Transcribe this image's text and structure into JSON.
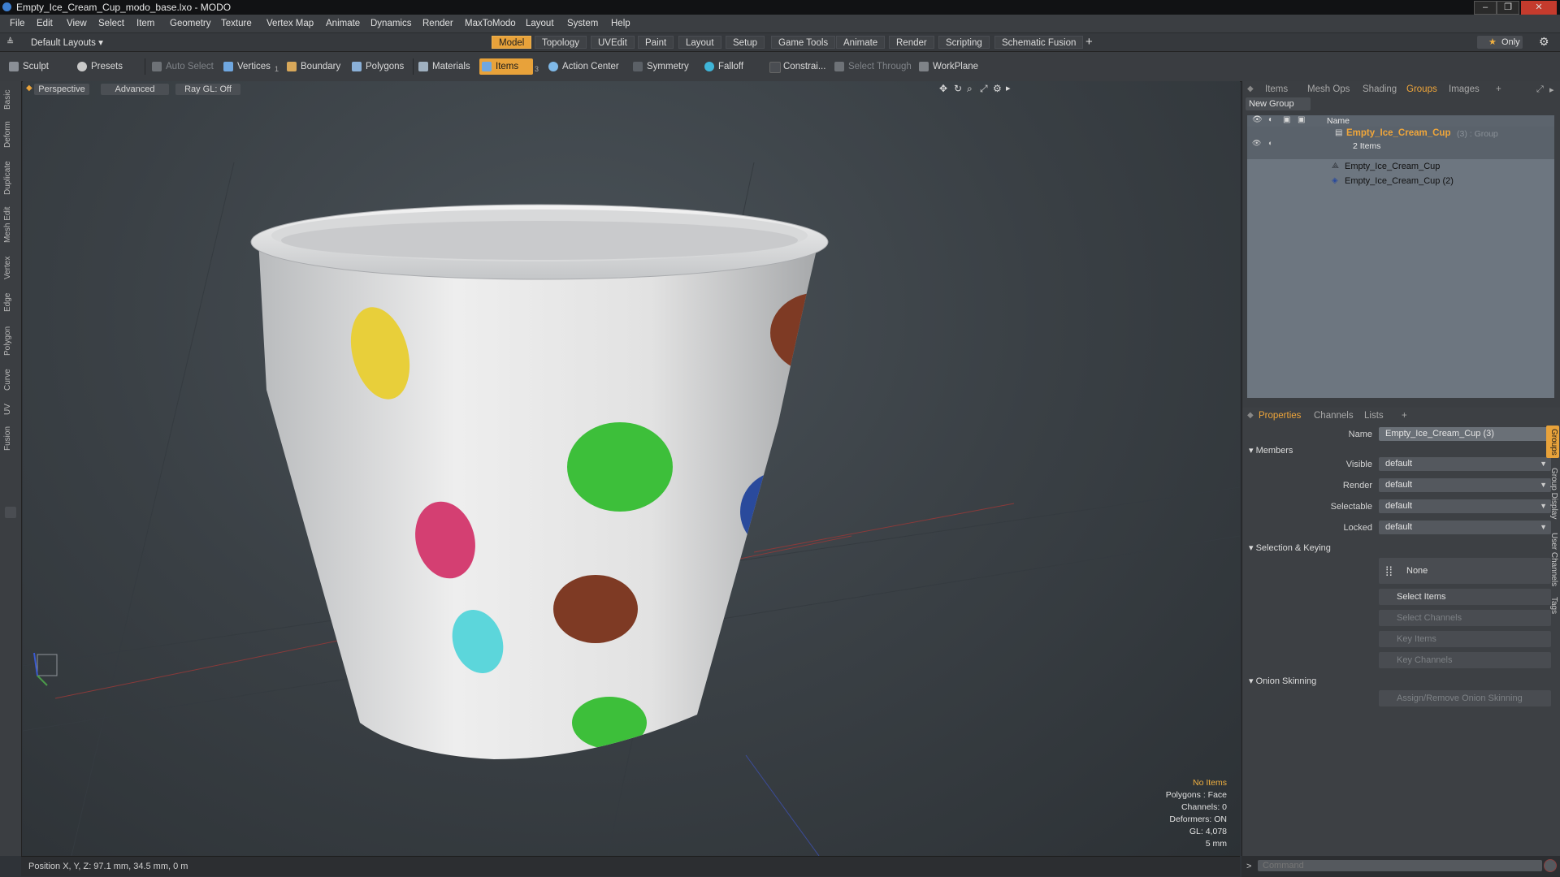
{
  "window": {
    "title": "Empty_Ice_Cream_Cup_modo_base.lxo - MODO",
    "min": "–",
    "max": "❐",
    "close": "✕"
  },
  "menu": [
    "File",
    "Edit",
    "View",
    "Select",
    "Item",
    "Geometry",
    "Texture",
    "Vertex Map",
    "Animate",
    "Dynamics",
    "Render",
    "MaxToModo",
    "Layout",
    "System",
    "Help"
  ],
  "layouts": {
    "selector": "Default Layouts ▾",
    "tabs": [
      "Model",
      "Topology",
      "UVEdit",
      "Paint",
      "Layout",
      "Setup",
      "Game Tools",
      "Animate",
      "Render",
      "Scripting",
      "Schematic Fusion"
    ],
    "active": "Model",
    "only_label": "Only",
    "add": "+"
  },
  "toolbar": {
    "sculpt": "Sculpt",
    "presets": "Presets",
    "auto_select": "Auto Select",
    "vertices": "Vertices",
    "vertices_count": "1",
    "boundary": "Boundary",
    "polygons": "Polygons",
    "materials": "Materials",
    "items": "Items",
    "items_count": "3",
    "action_center": "Action Center",
    "symmetry": "Symmetry",
    "falloff": "Falloff",
    "constraints": "Constrai...",
    "select_through": "Select Through",
    "workplane": "WorkPlane"
  },
  "left_tabs": [
    "Basic",
    "Deform",
    "Duplicate",
    "Mesh Edit",
    "Vertex",
    "Edge",
    "Polygon",
    "Curve",
    "UV",
    "Fusion"
  ],
  "viewport": {
    "view": "Perspective",
    "shading": "Advanced",
    "raygl": "Ray GL: Off",
    "info": {
      "selection": "No Items",
      "polygons": "Polygons : Face",
      "channels": "Channels: 0",
      "deformers": "Deformers: ON",
      "gl": "GL: 4,078",
      "grid": "5 mm"
    },
    "colors": {
      "dot_yellow": "#e8cf3a",
      "dot_brown": "#7e3a24",
      "dot_green": "#3dbf3a",
      "dot_blue": "#2a4a9c",
      "dot_pink": "#d43f72",
      "dot_cyan": "#5cd6db",
      "dot_orange": "#e07722"
    }
  },
  "status": {
    "position": "Position X, Y, Z:  97.1 mm, 34.5 mm, 0 m"
  },
  "right_top": {
    "tabs": [
      "Items",
      "Mesh Ops",
      "Shading",
      "Groups",
      "Images"
    ],
    "active": "Groups",
    "add": "+",
    "new_group": "New Group",
    "column_name": "Name",
    "group": {
      "name": "Empty_Ice_Cream_Cup",
      "suffix": "(3) : Group",
      "count": "2 Items"
    },
    "children": [
      "Empty_Ice_Cream_Cup",
      "Empty_Ice_Cream_Cup (2)"
    ]
  },
  "properties": {
    "tabs": [
      "Properties",
      "Channels",
      "Lists"
    ],
    "active": "Properties",
    "add": "+",
    "name_label": "Name",
    "name_value": "Empty_Ice_Cream_Cup (3)",
    "members_head": "Members",
    "rows": [
      {
        "label": "Visible",
        "value": "default"
      },
      {
        "label": "Render",
        "value": "default"
      },
      {
        "label": "Selectable",
        "value": "default"
      },
      {
        "label": "Locked",
        "value": "default"
      }
    ],
    "selection_head": "Selection & Keying",
    "none_btn": "None",
    "select_items": "Select Items",
    "select_channels": "Select Channels",
    "key_items": "Key Items",
    "key_channels": "Key Channels",
    "onion_head": "Onion Skinning",
    "onion_btn": "Assign/Remove Onion Skinning",
    "side_tabs": [
      "Groups",
      "Group Display",
      "User Channels",
      "Tags"
    ]
  },
  "command": {
    "placeholder": "Command",
    "prompt": ">"
  }
}
